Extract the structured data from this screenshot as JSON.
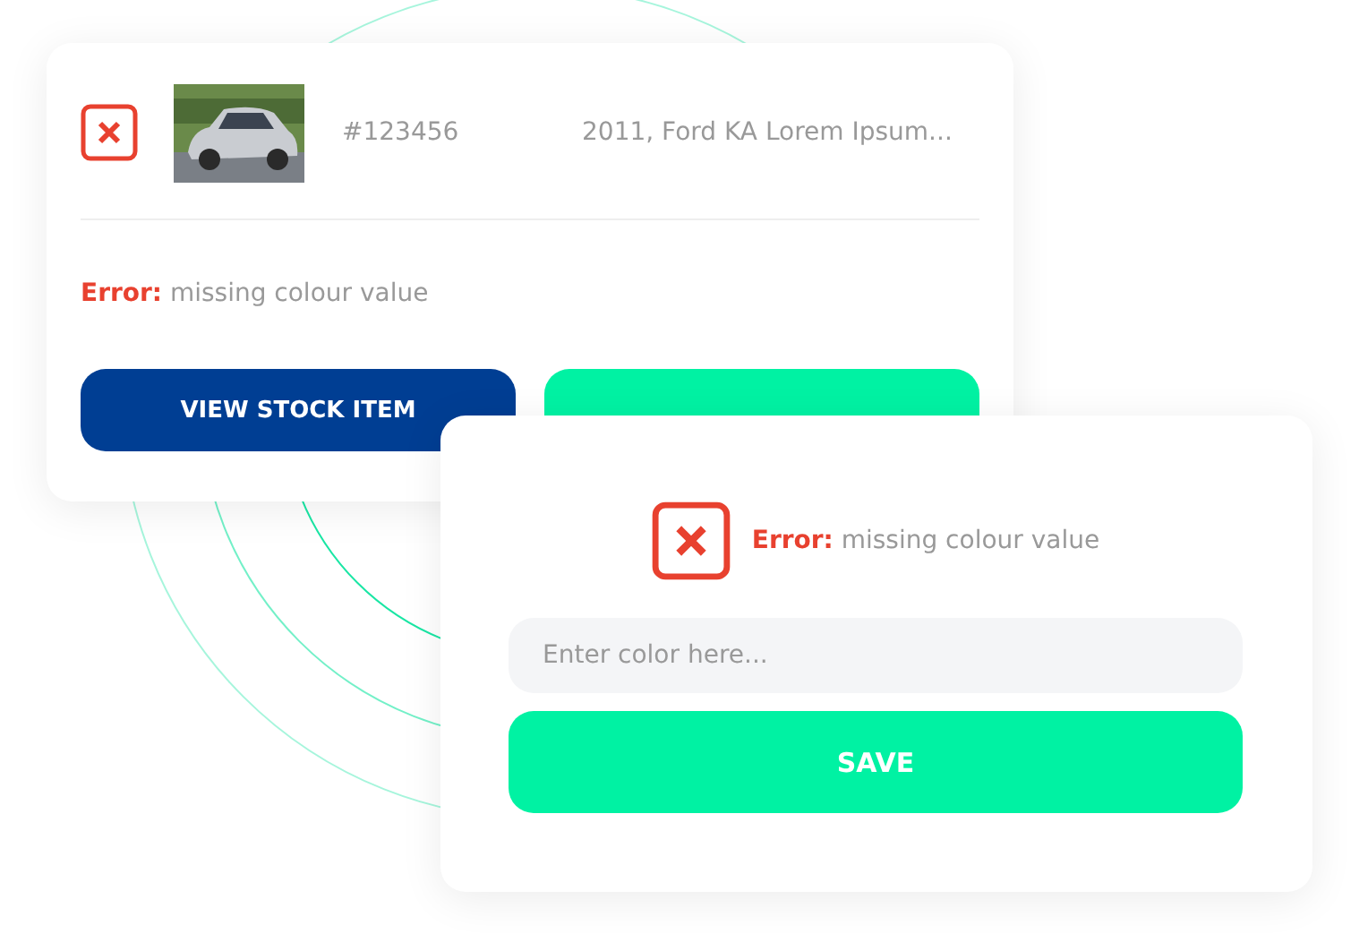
{
  "stock_card": {
    "has_error": true,
    "stock_number": "#123456",
    "description": "2011, Ford KA Lorem Ipsum...",
    "message": "**Error:** missing colour value",
    "buttons": [
      {
        "label": "VIEW STOCK ITEM",
        "kind": "primary"
      },
      {
        "kind": "accent"
      }
    ]
  },
  "fix_dialog": {
    "has_error": true,
    "message": "**Error:** missing colour value",
    "input": {
      "placeholder": "Enter color here..."
    },
    "button": {
      "label": "SAVE",
      "kind": "accent"
    }
  }
}
